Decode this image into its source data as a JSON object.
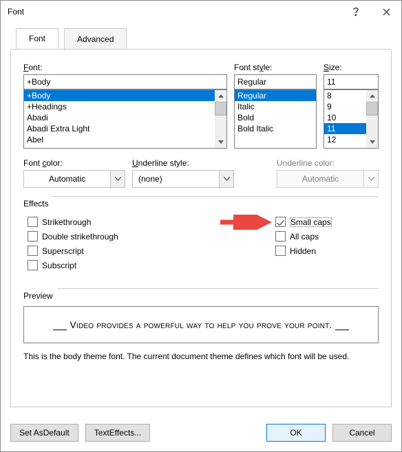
{
  "title": "Font",
  "tabs": {
    "font": "Font",
    "advanced": "Advanced"
  },
  "font": {
    "label_prefix": "F",
    "label_rest": "ont:",
    "value": "+Body",
    "items": [
      "+Body",
      "+Headings",
      "Abadi",
      "Abadi Extra Light",
      "Abel"
    ],
    "selected": "+Body"
  },
  "style": {
    "label": "Font style:",
    "label_ul": "y",
    "value": "Regular",
    "items": [
      "Regular",
      "Italic",
      "Bold",
      "Bold Italic"
    ],
    "selected": "Regular"
  },
  "size": {
    "label_prefix": "S",
    "label_rest": "ize:",
    "value": "11",
    "items": [
      "8",
      "9",
      "10",
      "11",
      "12"
    ],
    "selected": "11"
  },
  "color": {
    "label": "Font color:",
    "label_ul": "c",
    "value": "Automatic"
  },
  "underline_style": {
    "label_prefix": "U",
    "label_rest": "nderline style:",
    "value": "(none)"
  },
  "underline_color": {
    "label": "Underline color:",
    "value": "Automatic"
  },
  "effects_label": "Effects",
  "effects": {
    "strikethrough": "Strikethrough",
    "strikethrough_ul": "k",
    "double": "Double strikethrough",
    "double_ul": "l",
    "superscript": "Superscript",
    "superscript_ul": "p",
    "subscript": "Subscript",
    "subscript_ul": "b",
    "smallcaps": "Small caps",
    "smallcaps_ul": "m",
    "allcaps": "All caps",
    "allcaps_ul": "A",
    "hidden": "Hidden",
    "hidden_ul": "H"
  },
  "preview_label": "Preview",
  "preview_text": "Video provides a powerful way to help you prove your point.",
  "description": "This is the body theme font. The current document theme defines which font will be used.",
  "buttons": {
    "set_default": "Set As Default",
    "set_default_ul": "D",
    "text_effects": "Text Effects...",
    "text_effects_ul": "E",
    "ok": "OK",
    "cancel": "Cancel"
  }
}
